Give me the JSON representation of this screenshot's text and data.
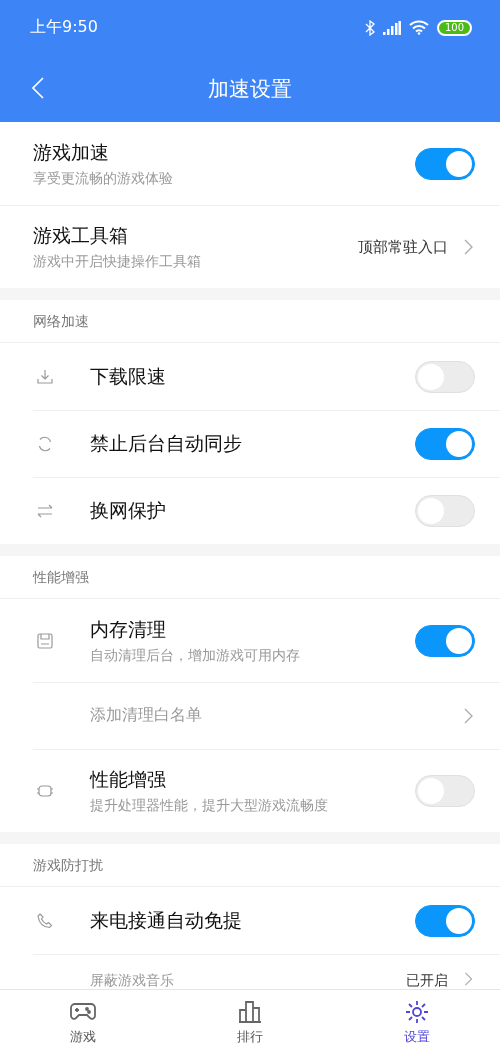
{
  "status_bar": {
    "time": "上午9:50",
    "battery": "100"
  },
  "header": {
    "title": "加速设置"
  },
  "top_items": [
    {
      "kind": "toggle",
      "title": "游戏加速",
      "subtitle": "享受更流畅的游戏体验",
      "on": true
    },
    {
      "kind": "link",
      "title": "游戏工具箱",
      "subtitle": "游戏中开启快捷操作工具箱",
      "value": "顶部常驻入口"
    }
  ],
  "sections": [
    {
      "title": "网络加速",
      "items": [
        {
          "kind": "toggle",
          "title": "下载限速",
          "on": false
        },
        {
          "kind": "toggle",
          "title": "禁止后台自动同步",
          "on": true
        },
        {
          "kind": "toggle",
          "title": "换网保护",
          "on": false
        }
      ]
    },
    {
      "title": "性能增强",
      "items": [
        {
          "kind": "toggle",
          "title": "内存清理",
          "subtitle": "自动清理后台，增加游戏可用内存",
          "on": true
        },
        {
          "kind": "sublink",
          "title": "添加清理白名单"
        },
        {
          "kind": "toggle",
          "title": "性能增强",
          "subtitle": "提升处理器性能，提升大型游戏流畅度",
          "on": false
        }
      ]
    },
    {
      "title": "游戏防打扰",
      "items": [
        {
          "kind": "toggle",
          "title": "来电接通自动免提",
          "on": true
        },
        {
          "kind": "sublink",
          "title": "屏蔽游戏音乐",
          "value": "已开启"
        }
      ]
    }
  ],
  "bottom_nav": [
    {
      "label": "游戏",
      "selected": false
    },
    {
      "label": "排行",
      "selected": false
    },
    {
      "label": "设置",
      "selected": true
    }
  ]
}
